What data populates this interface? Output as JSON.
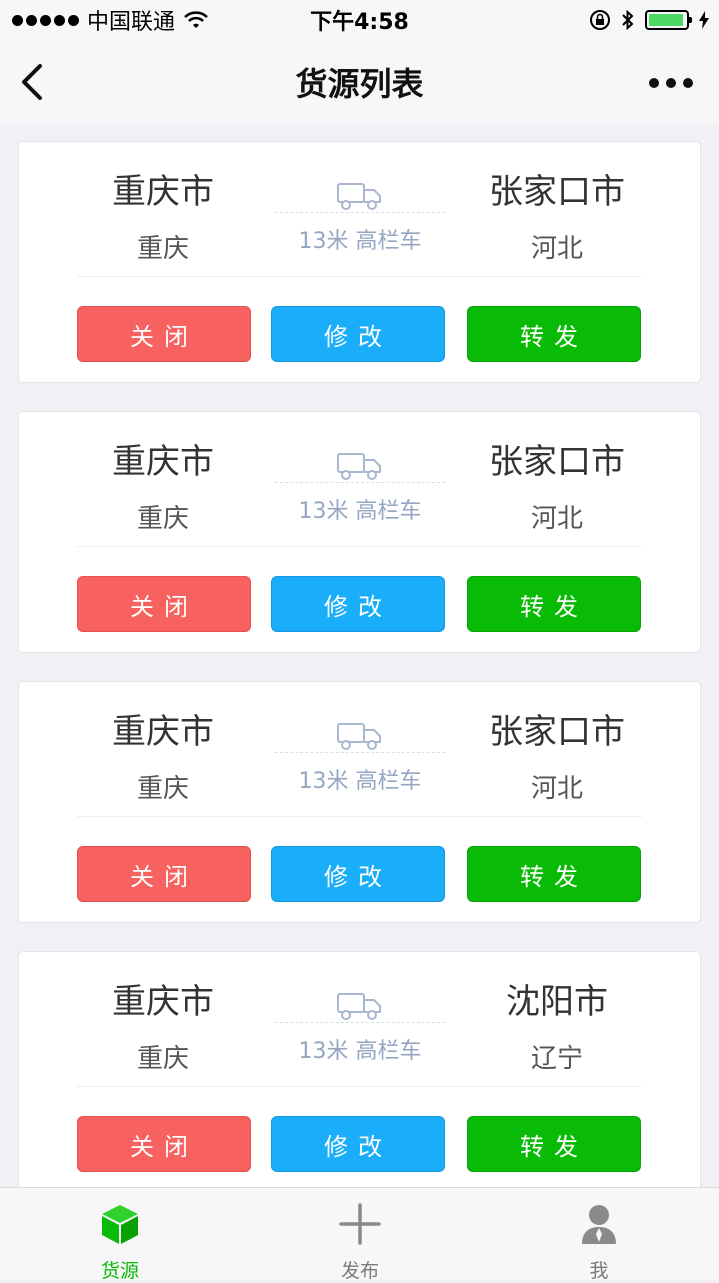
{
  "status_bar": {
    "carrier": "中国联通",
    "time": "下午4:58",
    "battery_level": 0.95,
    "icons": [
      "signal-dots-icon",
      "wifi-icon",
      "rotation-lock-icon",
      "bluetooth-icon",
      "battery-icon",
      "charging-icon"
    ]
  },
  "nav": {
    "title": "货源列表",
    "icons": [
      "back-chevron-icon",
      "more-dots-icon"
    ]
  },
  "cards": [
    {
      "from_city": "重庆市",
      "from_province": "重庆",
      "to_city": "张家口市",
      "to_province": "河北",
      "vehicle": "13米 高栏车"
    },
    {
      "from_city": "重庆市",
      "from_province": "重庆",
      "to_city": "张家口市",
      "to_province": "河北",
      "vehicle": "13米 高栏车"
    },
    {
      "from_city": "重庆市",
      "from_province": "重庆",
      "to_city": "张家口市",
      "to_province": "河北",
      "vehicle": "13米 高栏车"
    },
    {
      "from_city": "重庆市",
      "from_province": "重庆",
      "to_city": "沈阳市",
      "to_province": "辽宁",
      "vehicle": "13米 高栏车"
    }
  ],
  "buttons": {
    "close": "关闭",
    "edit": "修改",
    "share": "转发"
  },
  "colors": {
    "close": "#f76260",
    "edit": "#1aadf9",
    "share": "#09bb07",
    "active_tab": "#09bb07"
  },
  "tabs": [
    {
      "label": "货源",
      "icon": "cube-icon",
      "active": true
    },
    {
      "label": "发布",
      "icon": "plus-icon",
      "active": false
    },
    {
      "label": "我",
      "icon": "user-icon",
      "active": false
    }
  ]
}
